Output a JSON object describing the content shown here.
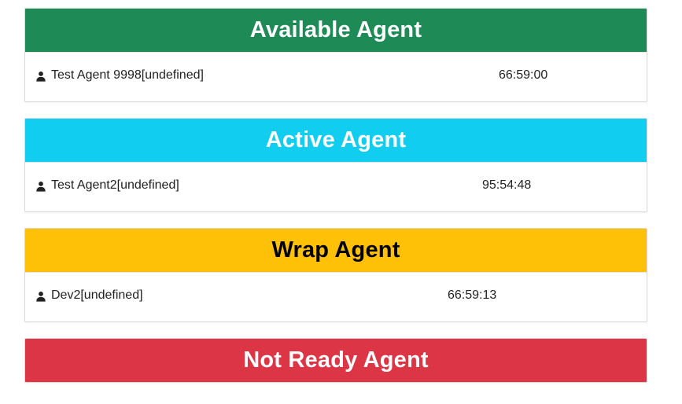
{
  "panels": {
    "available": {
      "title": "Available Agent",
      "color": "#1e8a56",
      "text_color": "#ffffff",
      "agents": [
        {
          "name": "Test Agent 9998[undefined]",
          "time": "66:59:00",
          "icon": "user-icon"
        }
      ]
    },
    "active": {
      "title": "Active Agent",
      "color": "#11cdf0",
      "text_color": "#ffffff",
      "agents": [
        {
          "name": "Test Agent2[undefined]",
          "time": "95:54:48",
          "icon": "user-icon"
        }
      ]
    },
    "wrap": {
      "title": "Wrap Agent",
      "color": "#ffc107",
      "text_color": "#000000",
      "agents": [
        {
          "name": "Dev2[undefined]",
          "time": "66:59:13",
          "icon": "user-icon"
        }
      ]
    },
    "not_ready": {
      "title": "Not Ready Agent",
      "color": "#dc3545",
      "text_color": "#ffffff",
      "agents": []
    }
  }
}
